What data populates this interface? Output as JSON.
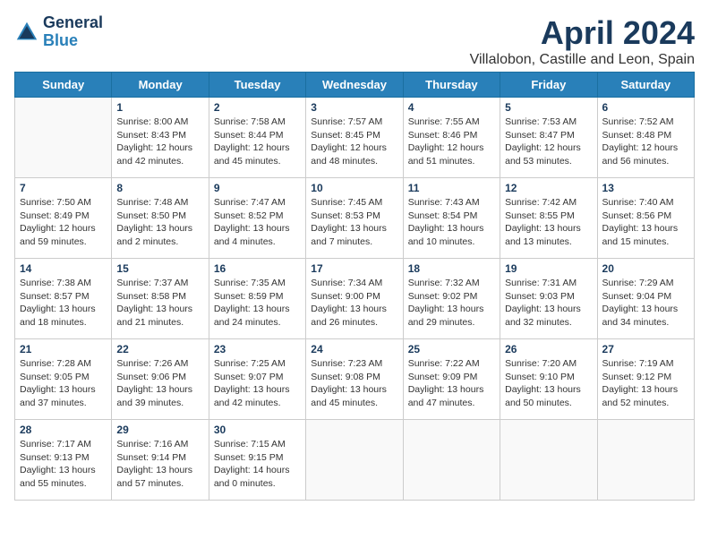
{
  "header": {
    "logo_line1": "General",
    "logo_line2": "Blue",
    "title": "April 2024",
    "subtitle": "Villalobon, Castille and Leon, Spain"
  },
  "weekdays": [
    "Sunday",
    "Monday",
    "Tuesday",
    "Wednesday",
    "Thursday",
    "Friday",
    "Saturday"
  ],
  "weeks": [
    [
      {
        "day": "",
        "sunrise": "",
        "sunset": "",
        "daylight": "",
        "empty": true
      },
      {
        "day": "1",
        "sunrise": "Sunrise: 8:00 AM",
        "sunset": "Sunset: 8:43 PM",
        "daylight": "Daylight: 12 hours and 42 minutes."
      },
      {
        "day": "2",
        "sunrise": "Sunrise: 7:58 AM",
        "sunset": "Sunset: 8:44 PM",
        "daylight": "Daylight: 12 hours and 45 minutes."
      },
      {
        "day": "3",
        "sunrise": "Sunrise: 7:57 AM",
        "sunset": "Sunset: 8:45 PM",
        "daylight": "Daylight: 12 hours and 48 minutes."
      },
      {
        "day": "4",
        "sunrise": "Sunrise: 7:55 AM",
        "sunset": "Sunset: 8:46 PM",
        "daylight": "Daylight: 12 hours and 51 minutes."
      },
      {
        "day": "5",
        "sunrise": "Sunrise: 7:53 AM",
        "sunset": "Sunset: 8:47 PM",
        "daylight": "Daylight: 12 hours and 53 minutes."
      },
      {
        "day": "6",
        "sunrise": "Sunrise: 7:52 AM",
        "sunset": "Sunset: 8:48 PM",
        "daylight": "Daylight: 12 hours and 56 minutes."
      }
    ],
    [
      {
        "day": "7",
        "sunrise": "Sunrise: 7:50 AM",
        "sunset": "Sunset: 8:49 PM",
        "daylight": "Daylight: 12 hours and 59 minutes."
      },
      {
        "day": "8",
        "sunrise": "Sunrise: 7:48 AM",
        "sunset": "Sunset: 8:50 PM",
        "daylight": "Daylight: 13 hours and 2 minutes."
      },
      {
        "day": "9",
        "sunrise": "Sunrise: 7:47 AM",
        "sunset": "Sunset: 8:52 PM",
        "daylight": "Daylight: 13 hours and 4 minutes."
      },
      {
        "day": "10",
        "sunrise": "Sunrise: 7:45 AM",
        "sunset": "Sunset: 8:53 PM",
        "daylight": "Daylight: 13 hours and 7 minutes."
      },
      {
        "day": "11",
        "sunrise": "Sunrise: 7:43 AM",
        "sunset": "Sunset: 8:54 PM",
        "daylight": "Daylight: 13 hours and 10 minutes."
      },
      {
        "day": "12",
        "sunrise": "Sunrise: 7:42 AM",
        "sunset": "Sunset: 8:55 PM",
        "daylight": "Daylight: 13 hours and 13 minutes."
      },
      {
        "day": "13",
        "sunrise": "Sunrise: 7:40 AM",
        "sunset": "Sunset: 8:56 PM",
        "daylight": "Daylight: 13 hours and 15 minutes."
      }
    ],
    [
      {
        "day": "14",
        "sunrise": "Sunrise: 7:38 AM",
        "sunset": "Sunset: 8:57 PM",
        "daylight": "Daylight: 13 hours and 18 minutes."
      },
      {
        "day": "15",
        "sunrise": "Sunrise: 7:37 AM",
        "sunset": "Sunset: 8:58 PM",
        "daylight": "Daylight: 13 hours and 21 minutes."
      },
      {
        "day": "16",
        "sunrise": "Sunrise: 7:35 AM",
        "sunset": "Sunset: 8:59 PM",
        "daylight": "Daylight: 13 hours and 24 minutes."
      },
      {
        "day": "17",
        "sunrise": "Sunrise: 7:34 AM",
        "sunset": "Sunset: 9:00 PM",
        "daylight": "Daylight: 13 hours and 26 minutes."
      },
      {
        "day": "18",
        "sunrise": "Sunrise: 7:32 AM",
        "sunset": "Sunset: 9:02 PM",
        "daylight": "Daylight: 13 hours and 29 minutes."
      },
      {
        "day": "19",
        "sunrise": "Sunrise: 7:31 AM",
        "sunset": "Sunset: 9:03 PM",
        "daylight": "Daylight: 13 hours and 32 minutes."
      },
      {
        "day": "20",
        "sunrise": "Sunrise: 7:29 AM",
        "sunset": "Sunset: 9:04 PM",
        "daylight": "Daylight: 13 hours and 34 minutes."
      }
    ],
    [
      {
        "day": "21",
        "sunrise": "Sunrise: 7:28 AM",
        "sunset": "Sunset: 9:05 PM",
        "daylight": "Daylight: 13 hours and 37 minutes."
      },
      {
        "day": "22",
        "sunrise": "Sunrise: 7:26 AM",
        "sunset": "Sunset: 9:06 PM",
        "daylight": "Daylight: 13 hours and 39 minutes."
      },
      {
        "day": "23",
        "sunrise": "Sunrise: 7:25 AM",
        "sunset": "Sunset: 9:07 PM",
        "daylight": "Daylight: 13 hours and 42 minutes."
      },
      {
        "day": "24",
        "sunrise": "Sunrise: 7:23 AM",
        "sunset": "Sunset: 9:08 PM",
        "daylight": "Daylight: 13 hours and 45 minutes."
      },
      {
        "day": "25",
        "sunrise": "Sunrise: 7:22 AM",
        "sunset": "Sunset: 9:09 PM",
        "daylight": "Daylight: 13 hours and 47 minutes."
      },
      {
        "day": "26",
        "sunrise": "Sunrise: 7:20 AM",
        "sunset": "Sunset: 9:10 PM",
        "daylight": "Daylight: 13 hours and 50 minutes."
      },
      {
        "day": "27",
        "sunrise": "Sunrise: 7:19 AM",
        "sunset": "Sunset: 9:12 PM",
        "daylight": "Daylight: 13 hours and 52 minutes."
      }
    ],
    [
      {
        "day": "28",
        "sunrise": "Sunrise: 7:17 AM",
        "sunset": "Sunset: 9:13 PM",
        "daylight": "Daylight: 13 hours and 55 minutes."
      },
      {
        "day": "29",
        "sunrise": "Sunrise: 7:16 AM",
        "sunset": "Sunset: 9:14 PM",
        "daylight": "Daylight: 13 hours and 57 minutes."
      },
      {
        "day": "30",
        "sunrise": "Sunrise: 7:15 AM",
        "sunset": "Sunset: 9:15 PM",
        "daylight": "Daylight: 14 hours and 0 minutes."
      },
      {
        "day": "",
        "sunrise": "",
        "sunset": "",
        "daylight": "",
        "empty": true
      },
      {
        "day": "",
        "sunrise": "",
        "sunset": "",
        "daylight": "",
        "empty": true
      },
      {
        "day": "",
        "sunrise": "",
        "sunset": "",
        "daylight": "",
        "empty": true
      },
      {
        "day": "",
        "sunrise": "",
        "sunset": "",
        "daylight": "",
        "empty": true
      }
    ]
  ]
}
